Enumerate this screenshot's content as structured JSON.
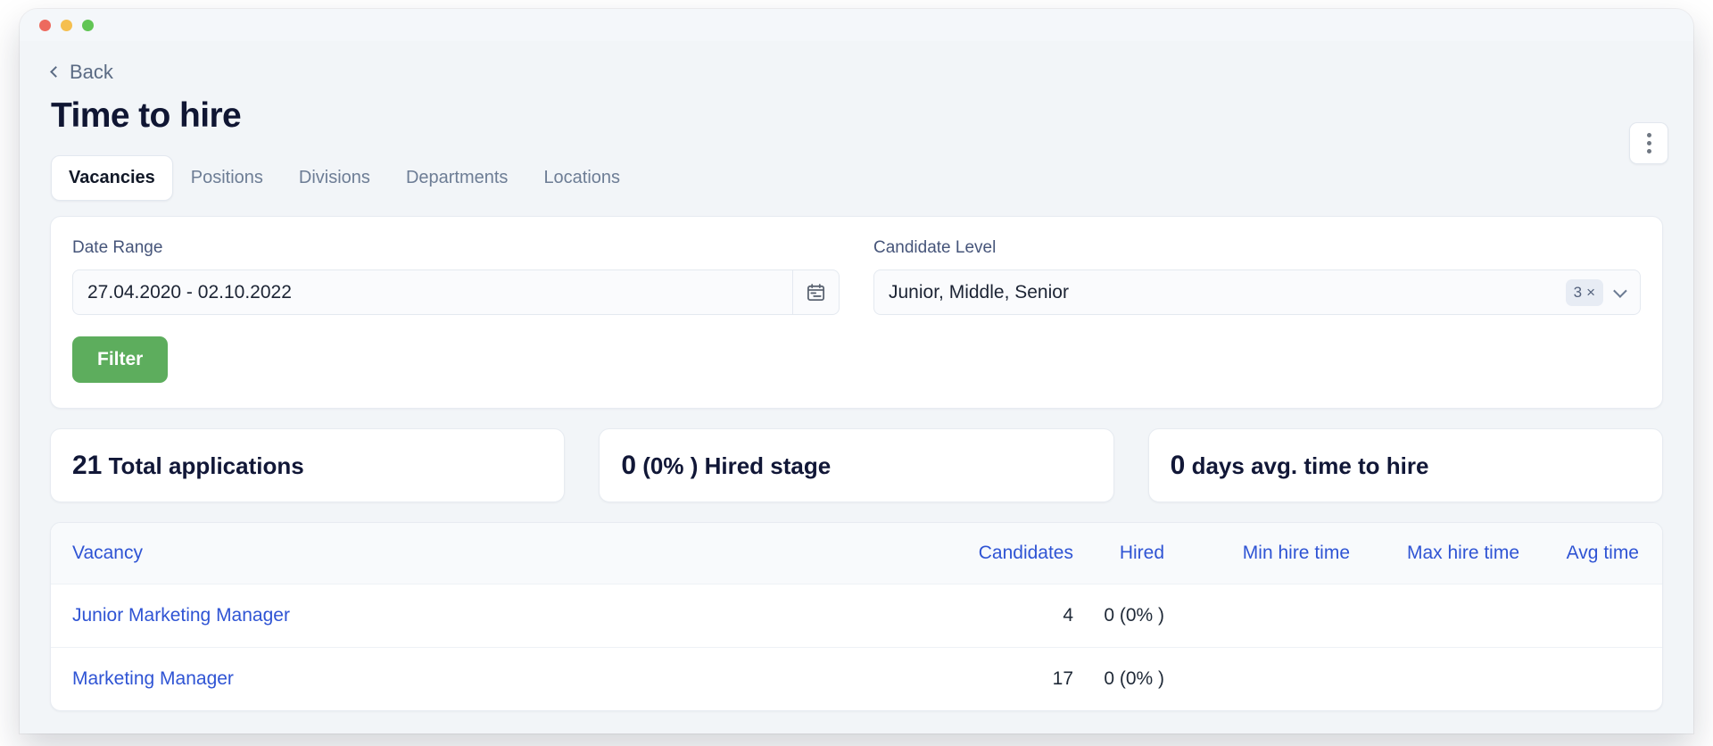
{
  "window": {
    "traffic_lights": [
      "close-red",
      "minimize-yellow",
      "maximize-green"
    ]
  },
  "header": {
    "back_label": "Back",
    "back_icon": "chevron-left-icon",
    "title": "Time to hire",
    "menu_icon": "kebab-menu-icon"
  },
  "tabs": [
    {
      "label": "Vacancies",
      "active": true
    },
    {
      "label": "Positions",
      "active": false
    },
    {
      "label": "Divisions",
      "active": false
    },
    {
      "label": "Departments",
      "active": false
    },
    {
      "label": "Locations",
      "active": false
    }
  ],
  "filters": {
    "date_range": {
      "label": "Date Range",
      "value": "27.04.2020 - 02.10.2022",
      "placeholder": "Select date range",
      "icon": "calendar-icon"
    },
    "candidate_level": {
      "label": "Candidate Level",
      "value": "Junior, Middle, Senior",
      "placeholder": "Select level",
      "count_badge": "3",
      "clear_glyph": "×",
      "dropdown_icon": "chevron-down-icon",
      "options": [
        "Junior",
        "Middle",
        "Senior"
      ]
    },
    "submit_label": "Filter",
    "submit_color": "#5dad5d"
  },
  "stats": [
    {
      "value": "21",
      "label": "Total applications"
    },
    {
      "value": "0",
      "label": "(0% ) Hired stage"
    },
    {
      "value": "0",
      "label": "days avg. time to hire"
    }
  ],
  "table": {
    "columns": [
      "Vacancy",
      "Candidates",
      "Hired",
      "Min hire time",
      "Max hire time",
      "Avg time"
    ],
    "header_color": "#2f54d4",
    "rows": [
      {
        "vacancy": "Junior Marketing Manager",
        "candidates": "4",
        "hired": "0 (0% )",
        "min": "",
        "max": "",
        "avg": ""
      },
      {
        "vacancy": "Marketing Manager",
        "candidates": "17",
        "hired": "0 (0% )",
        "min": "",
        "max": "",
        "avg": ""
      }
    ]
  }
}
